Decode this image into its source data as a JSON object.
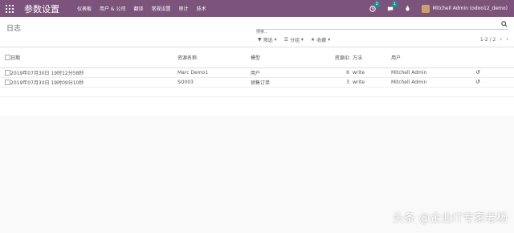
{
  "topbar": {
    "app_title": "参数设置",
    "menu": [
      "仪表板",
      "用户 & 公司",
      "翻译",
      "常规设置",
      "审计",
      "技术"
    ],
    "activity_count": "2",
    "message_count": "1",
    "user_name": "Mitchell Admin (odoo12_demo)"
  },
  "control": {
    "breadcrumb": "日志",
    "search_placeholder": "搜索...",
    "filters": [
      {
        "icon": "filter-icon",
        "label": "筛选"
      },
      {
        "icon": "group-icon",
        "label": "分组"
      },
      {
        "icon": "star-icon",
        "label": "收藏"
      }
    ],
    "pager": "1-2 / 2"
  },
  "table": {
    "headers": [
      "日期",
      "资源名称",
      "模型",
      "资源ID",
      "方法",
      "用户"
    ],
    "rows": [
      {
        "date": "2019年07月30日 19时12分58秒",
        "name": "Marc Demo1",
        "model": "用户",
        "id": "6",
        "method": "write",
        "user": "Mitchell Admin"
      },
      {
        "date": "2019年07月30日 19时09分10秒",
        "name": "SO003",
        "model": "销售订单",
        "id": "3",
        "method": "write",
        "user": "Mitchell Admin"
      }
    ]
  },
  "watermark": "头条 @企业IT专家老杨",
  "colors": {
    "brand": "#7c547b",
    "badge": "#00a09d"
  }
}
